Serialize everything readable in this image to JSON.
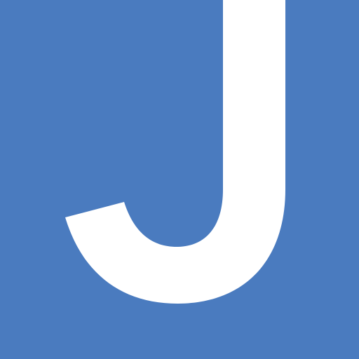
{
  "icon": {
    "letter": "J",
    "background_color": "#4a7bbf",
    "letter_color": "#ffffff",
    "icon_name": "letter-j-logo-icon"
  }
}
